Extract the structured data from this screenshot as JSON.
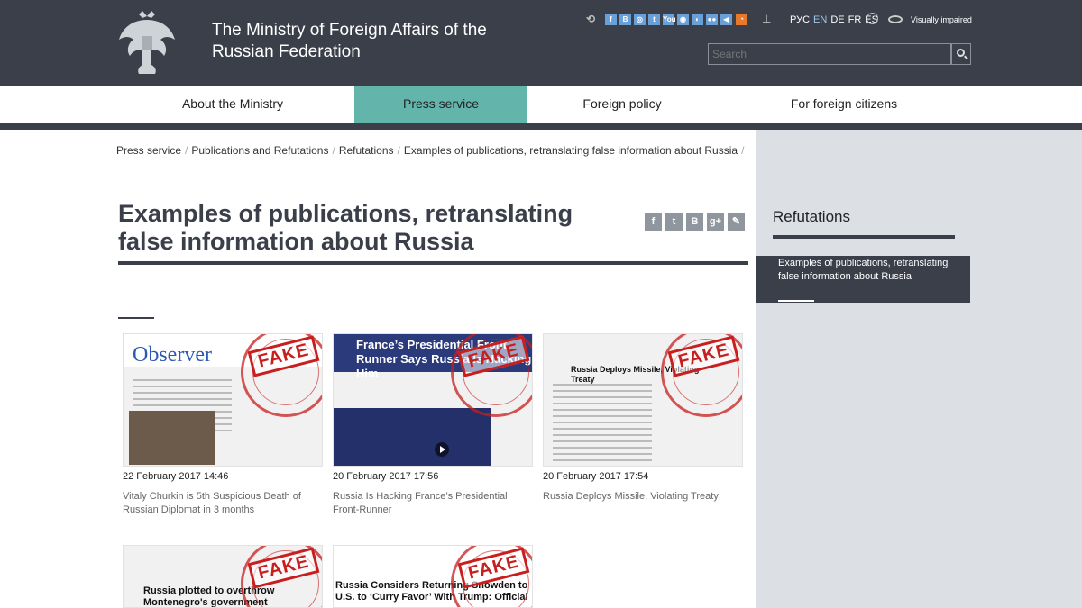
{
  "header": {
    "title": "The Ministry of Foreign Affairs of the Russian Federation",
    "social": [
      "f",
      "B",
      "◎",
      "t",
      "You",
      "◉",
      "◐",
      "●●",
      "◀"
    ],
    "languages": [
      "РУС",
      "EN",
      "DE",
      "FR",
      "ES"
    ],
    "current_language": "EN",
    "visually_impaired": "Visually impaired",
    "search_placeholder": "Search"
  },
  "nav": {
    "items": [
      "About the Ministry",
      "Press service",
      "Foreign policy",
      "For foreign citizens"
    ],
    "active": "Press service"
  },
  "breadcrumb": [
    "Press service",
    "Publications and Refutations",
    "Refutations",
    "Examples of publications, retranslating false information about Russia"
  ],
  "page": {
    "title": "Examples of publications, retranslating false information about Russia",
    "share": [
      "f",
      "t",
      "B",
      "g+",
      "✎"
    ]
  },
  "sidebar": {
    "title": "Refutations",
    "active_item": "Examples of publications, retranslating false information about Russia"
  },
  "cards": [
    {
      "date": "22 February 2017 14:46",
      "title": "Vitaly Churkin is 5th Suspicious Death of Russian Diplomat in 3 months",
      "thumb_text": "Observer",
      "stamp": "FAKE"
    },
    {
      "date": "20 February 2017 17:56",
      "title": "Russia Is Hacking France’s Presidential Front-Runner",
      "thumb_text": "France’s Presidential Front-Runner Says Russia Is Hacking Him",
      "stamp": "FAKE"
    },
    {
      "date": "20 February 2017 17:54",
      "title": "Russia Deploys Missile, Violating Treaty",
      "thumb_text": "Russia Deploys Missile, Violating Treaty",
      "stamp": "FAKE"
    },
    {
      "date": "",
      "title": "",
      "thumb_text": "Russia plotted to overthrow Montenegro's government by",
      "stamp": "FAKE"
    },
    {
      "date": "",
      "title": "",
      "thumb_text": "Russia Considers Returning Snowden to U.S. to ‘Curry Favor’ With Trump: Official",
      "stamp": "FAKE"
    }
  ],
  "colors": {
    "header_bg": "#3a3f4a",
    "nav_active": "#63b5ac",
    "sidebar_bg": "#dcdfe3",
    "stamp_red": "#c81e1e"
  }
}
